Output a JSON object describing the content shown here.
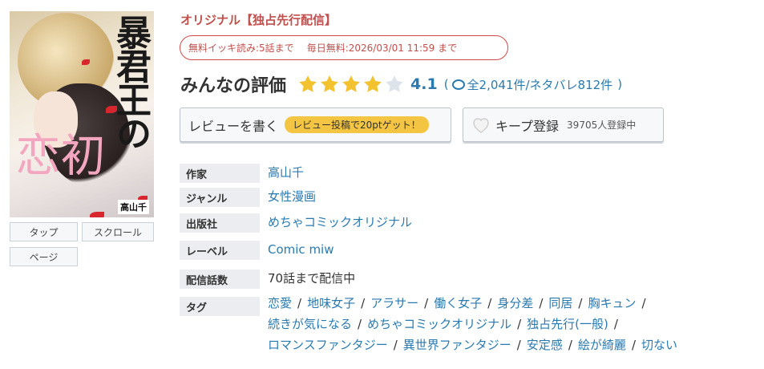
{
  "cover": {
    "title_kanji": "暴君王の",
    "title_hira": "の",
    "title_pink": "初恋",
    "author_tag": "高山千"
  },
  "cover_buttons": {
    "tap": "タップ",
    "scroll": "スクロール",
    "page": "ページ"
  },
  "origin_label": "オリジナル【独占先行配信】",
  "free": {
    "ikki": "無料イッキ読み:5話まで",
    "daily": "毎日無料:2026/03/01 11:59 まで"
  },
  "rating": {
    "title": "みんなの評価",
    "stars": 4,
    "score": "4.1",
    "open": "(",
    "total": "全2,041件/ネタバレ812件",
    "close": ")"
  },
  "review_button": {
    "label": "レビューを書く",
    "badge": "レビュー投稿で20ptゲット！"
  },
  "keep_button": {
    "label": "キープ登録",
    "count": "39705人登録中"
  },
  "info": {
    "author_label": "作家",
    "author": "高山千",
    "genre_label": "ジャンル",
    "genre": "女性漫画",
    "publisher_label": "出版社",
    "publisher": "めちゃコミックオリジナル",
    "label_label": "レーベル",
    "label": "Comic miw",
    "episodes_label": "配信話数",
    "episodes": "70話まで配信中",
    "tags_label": "タグ",
    "tags": [
      "恋愛",
      "地味女子",
      "アラサー",
      "働く女子",
      "身分差",
      "同居",
      "胸キュン",
      "続きが気になる",
      "めちゃコミックオリジナル",
      "独占先行(一般)",
      "ロマンスファンタジー",
      "異世界ファンタジー",
      "安定感",
      "絵が綺麗",
      "切ない"
    ]
  },
  "colors": {
    "link": "#2a7ab0",
    "star": "#f2c230",
    "accent_red": "#c0504d"
  }
}
